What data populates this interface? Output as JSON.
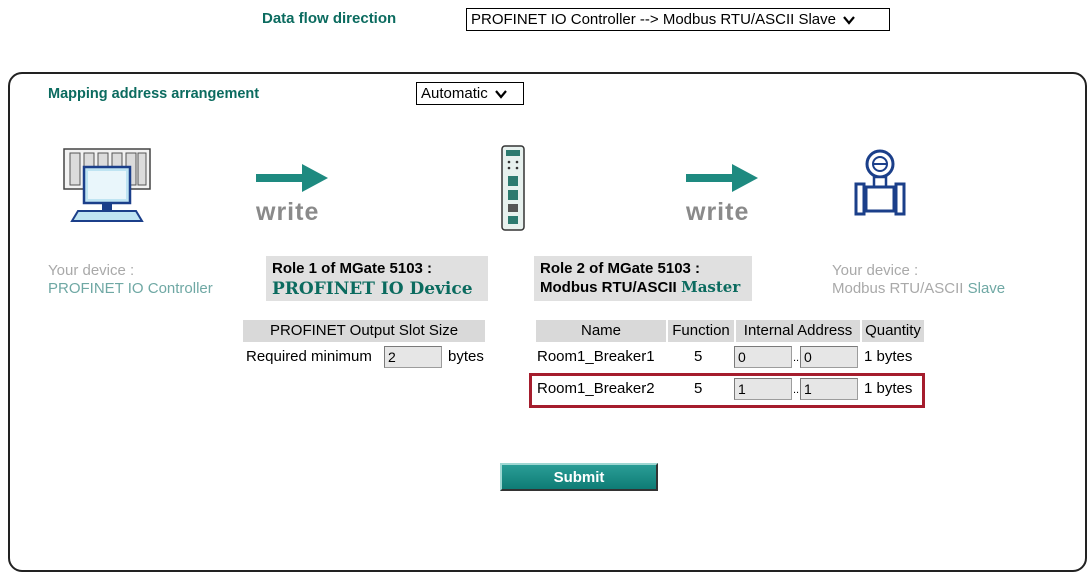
{
  "top": {
    "label": "Data flow direction",
    "select_value": "PROFINET IO Controller --> Modbus RTU/ASCII Slave"
  },
  "mapping": {
    "label": "Mapping address arrangement",
    "select_value": "Automatic"
  },
  "flow": {
    "write_left": "write",
    "write_right": "write"
  },
  "left_device": {
    "line1": "Your device :",
    "line2": "PROFINET IO Controller"
  },
  "right_device": {
    "line1": "Your device :",
    "line2_a": "Modbus RTU/ASCII",
    "line2_b": "Slave"
  },
  "role1": {
    "title": "Role 1 of MGate 5103 :",
    "name": "PROFINET IO Device"
  },
  "role2": {
    "title": "Role 2 of MGate 5103 :",
    "name_a": "Modbus RTU/ASCII",
    "name_b": "Master"
  },
  "slot": {
    "header": "PROFINET Output Slot Size",
    "label": "Required minimum",
    "value": "2",
    "unit": "bytes"
  },
  "commands": {
    "headers": [
      "Name",
      "Function",
      "Internal Address",
      "Quantity"
    ],
    "rows": [
      {
        "name": "Room1_Breaker1",
        "function": "5",
        "addr_from": "0",
        "sep": "..",
        "addr_to": "0",
        "quantity": "1 bytes"
      },
      {
        "name": "Room1_Breaker2",
        "function": "5",
        "addr_from": "1",
        "sep": "..",
        "addr_to": "1",
        "quantity": "1 bytes"
      }
    ]
  },
  "submit_label": "Submit",
  "colors": {
    "teal": "#0b6b5f",
    "arrow": "#1e8a80",
    "highlight": "#a51d2d"
  },
  "icons": [
    "pc-controller-icon",
    "arrow-right-icon",
    "mgate-device-icon",
    "flow-meter-icon"
  ]
}
